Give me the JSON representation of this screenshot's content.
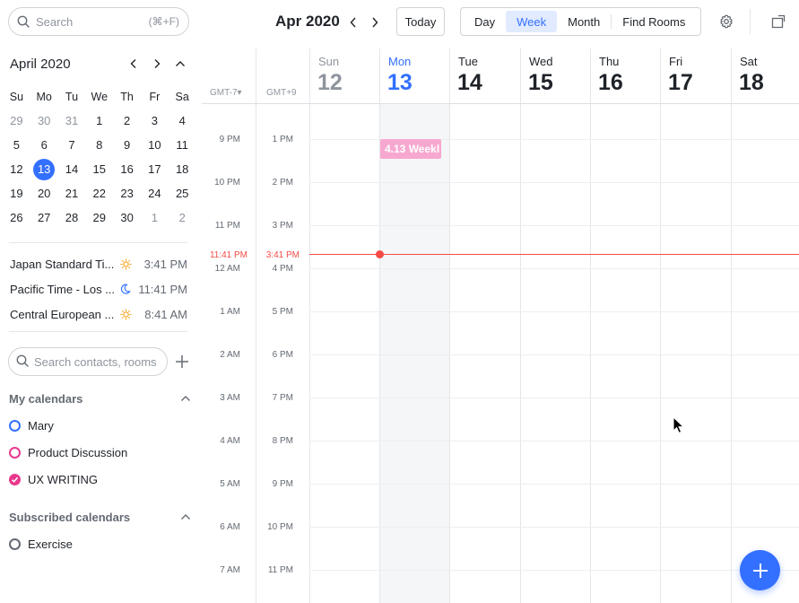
{
  "search": {
    "placeholder": "Search",
    "shortcut": "(⌘+F)"
  },
  "mini_calendar": {
    "month_label": "April 2020",
    "weekdays": [
      "Su",
      "Mo",
      "Tu",
      "We",
      "Th",
      "Fr",
      "Sa"
    ],
    "weeks": [
      [
        "29",
        "30",
        "31",
        "1",
        "2",
        "3",
        "4"
      ],
      [
        "5",
        "6",
        "7",
        "8",
        "9",
        "10",
        "11"
      ],
      [
        "12",
        "13",
        "14",
        "15",
        "16",
        "17",
        "18"
      ],
      [
        "19",
        "20",
        "21",
        "22",
        "23",
        "24",
        "25"
      ],
      [
        "26",
        "27",
        "28",
        "29",
        "30",
        "1",
        "2"
      ]
    ],
    "selected": "13"
  },
  "time_zones": [
    {
      "name": "Japan Standard Ti...",
      "icon": "sun-icon",
      "time": "3:41 PM"
    },
    {
      "name": "Pacific Time - Los ...",
      "icon": "moon-icon",
      "time": "11:41 PM"
    },
    {
      "name": "Central European ...",
      "icon": "sun-icon",
      "time": "8:41 AM"
    }
  ],
  "contact_search": {
    "placeholder": "Search contacts, rooms"
  },
  "my_calendars": {
    "title": "My calendars",
    "items": [
      {
        "name": "Mary",
        "color": "#3370ff",
        "checked": false
      },
      {
        "name": "Product Discussion",
        "color": "#e8388c",
        "checked": false
      },
      {
        "name": "UX WRITING",
        "color": "#e8388c",
        "checked": true
      }
    ]
  },
  "subscribed_calendars": {
    "title": "Subscribed calendars",
    "items": [
      {
        "name": "Exercise",
        "color": "#646a73",
        "checked": false
      }
    ]
  },
  "toolbar": {
    "title": "Apr 2020",
    "today_label": "Today",
    "views": [
      "Day",
      "Week",
      "Month",
      "Find Rooms"
    ],
    "active_view": "Week"
  },
  "week": {
    "days": [
      {
        "name": "Sun",
        "num": "12",
        "state": "past"
      },
      {
        "name": "Mon",
        "num": "13",
        "state": "today"
      },
      {
        "name": "Tue",
        "num": "14",
        "state": ""
      },
      {
        "name": "Wed",
        "num": "15",
        "state": ""
      },
      {
        "name": "Thu",
        "num": "16",
        "state": ""
      },
      {
        "name": "Fri",
        "num": "17",
        "state": ""
      },
      {
        "name": "Sat",
        "num": "18",
        "state": ""
      }
    ],
    "tz_primary": "GMT-7▾",
    "tz_secondary": "GMT+9",
    "hours_primary": [
      "9 PM",
      "10 PM",
      "11 PM",
      "12 AM",
      "1 AM",
      "2 AM",
      "3 AM",
      "4 AM",
      "5 AM",
      "6 AM",
      "7 AM"
    ],
    "hours_secondary": [
      "1 PM",
      "2 PM",
      "3 PM",
      "4 PM",
      "5 PM",
      "6 PM",
      "7 PM",
      "8 PM",
      "9 PM",
      "10 PM",
      "11 PM"
    ],
    "now_primary": "11:41 PM",
    "now_secondary": "3:41 PM"
  },
  "event": {
    "title": "4.13 Weekl",
    "color": "#f7a8d0"
  },
  "colors": {
    "accent": "#3370ff",
    "now": "#f54a45"
  }
}
